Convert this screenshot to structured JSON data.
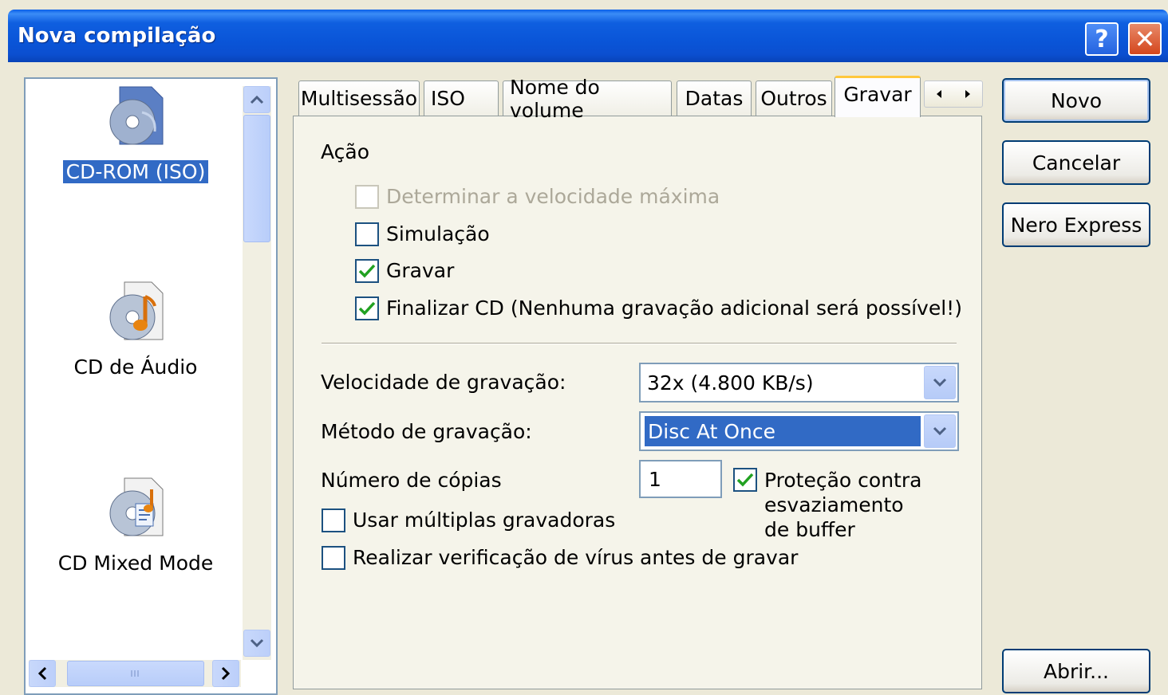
{
  "window": {
    "title": "Nova compilação",
    "help_glyph": "?",
    "close_glyph": "✕"
  },
  "compilation_list": {
    "items": [
      {
        "label": "CD-ROM (ISO)",
        "icon": "cd-rom-iso-icon",
        "selected": true
      },
      {
        "label": "CD de Áudio",
        "icon": "audio-cd-icon",
        "selected": false
      },
      {
        "label": "CD Mixed Mode",
        "icon": "mixed-mode-cd-icon",
        "selected": false
      }
    ]
  },
  "tabs": [
    {
      "label": "Multisessão",
      "active": false
    },
    {
      "label": "ISO",
      "active": false
    },
    {
      "label": "Nome do volume",
      "active": false
    },
    {
      "label": "Datas",
      "active": false
    },
    {
      "label": "Outros",
      "active": false
    },
    {
      "label": "Gravar",
      "active": true
    }
  ],
  "burn": {
    "action_label": "Ação",
    "options": [
      {
        "label": "Determinar a velocidade máxima",
        "checked": false,
        "enabled": false
      },
      {
        "label": "Simulação",
        "checked": false,
        "enabled": true
      },
      {
        "label": "Gravar",
        "checked": true,
        "enabled": true
      },
      {
        "label": "Finalizar CD (Nenhuma gravação adicional será possível!)",
        "checked": true,
        "enabled": true
      }
    ],
    "speed_label": "Velocidade de gravação:",
    "speed_value": "32x (4.800 KB/s)",
    "method_label": "Método de gravação:",
    "method_value": "Disc At Once",
    "copies_label": "Número de cópias",
    "copies_value": "1",
    "buffer_label": "Proteção contra esvaziamento de buffer",
    "buffer_checked": true,
    "multi_writers_label": "Usar múltiplas gravadoras",
    "multi_writers_checked": false,
    "virus_label": "Realizar verificação de vírus antes de gravar",
    "virus_checked": false
  },
  "buttons": {
    "new": "Novo",
    "cancel": "Cancelar",
    "express": "Nero Express",
    "open": "Abrir..."
  }
}
